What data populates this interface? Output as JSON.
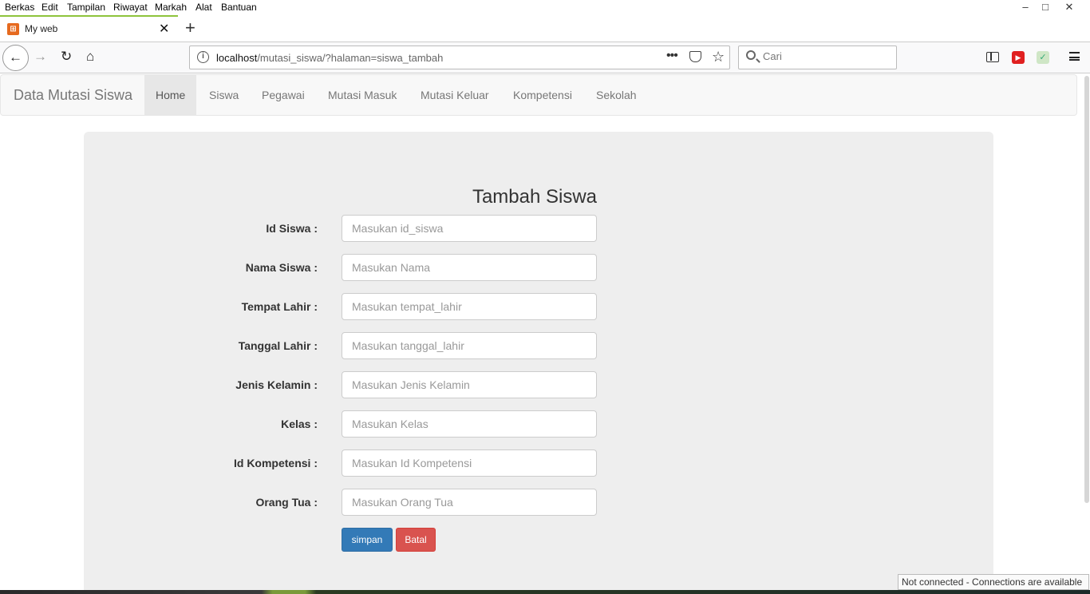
{
  "menubar": {
    "items": [
      "Berkas",
      "Edit",
      "Tampilan",
      "Riwayat",
      "Markah",
      "Alat",
      "Bantuan"
    ]
  },
  "tab": {
    "title": "My web",
    "favicon": "xampp-icon"
  },
  "urlbar": {
    "host": "localhost",
    "path": "/mutasi_siswa/?halaman=siswa_tambah"
  },
  "search": {
    "placeholder": "Cari"
  },
  "site": {
    "brand": "Data Mutasi Siswa",
    "nav": [
      "Home",
      "Siswa",
      "Pegawai",
      "Mutasi Masuk",
      "Mutasi Keluar",
      "Kompetensi",
      "Sekolah"
    ],
    "active_nav": "Home"
  },
  "form": {
    "title": "Tambah Siswa",
    "fields": [
      {
        "label": "Id Siswa :",
        "placeholder": "Masukan id_siswa"
      },
      {
        "label": "Nama Siswa :",
        "placeholder": "Masukan Nama"
      },
      {
        "label": "Tempat Lahir :",
        "placeholder": "Masukan tempat_lahir"
      },
      {
        "label": "Tanggal Lahir :",
        "placeholder": "Masukan tanggal_lahir"
      },
      {
        "label": "Jenis Kelamin :",
        "placeholder": "Masukan Jenis Kelamin"
      },
      {
        "label": "Kelas :",
        "placeholder": "Masukan Kelas"
      },
      {
        "label": "Id Kompetensi :",
        "placeholder": "Masukan Id Kompetensi"
      },
      {
        "label": "Orang Tua :",
        "placeholder": "Masukan Orang Tua"
      }
    ],
    "submit_label": "simpan",
    "cancel_label": "Batal"
  },
  "status": {
    "text": "Not connected - Connections are available"
  },
  "colors": {
    "primary": "#337ab7",
    "danger": "#d9534f",
    "tab_accent": "#8ec33c"
  }
}
